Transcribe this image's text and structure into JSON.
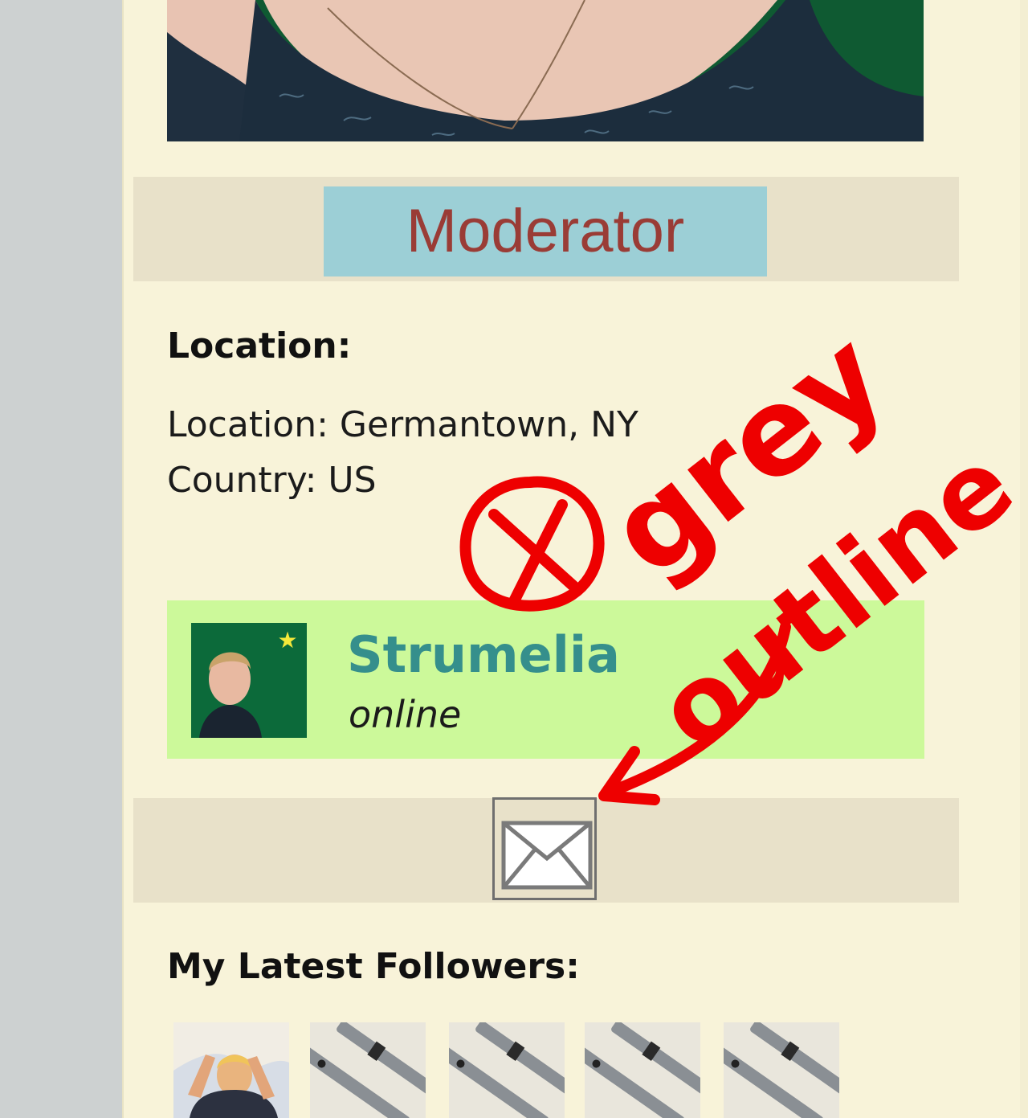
{
  "profile": {
    "role": "Moderator",
    "location_heading": "Location:",
    "location_line": "Location: Germantown, NY",
    "country_line": "Country: US"
  },
  "user_card": {
    "username": "Strumelia",
    "status": "online"
  },
  "message": {
    "icon": "envelope-icon"
  },
  "followers": {
    "heading": "My Latest Followers:",
    "count_visible": 5
  },
  "annotation": {
    "line1": "grey",
    "line2": "outline",
    "color": "#ee0000"
  },
  "colors": {
    "panel": "#f8f3d9",
    "role_badge": "#9ccfd6",
    "role_text": "#9a3c36",
    "user_card": "#ccf99a",
    "username": "#358f8c"
  }
}
